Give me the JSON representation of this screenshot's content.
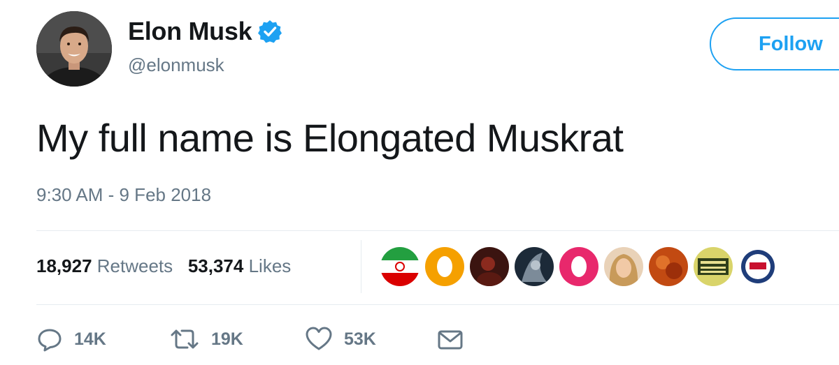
{
  "user": {
    "display_name": "Elon Musk",
    "handle": "@elonmusk",
    "verified": true
  },
  "follow_label": "Follow",
  "tweet": {
    "text": "My full name is Elongated Muskrat",
    "timestamp": "9:30 AM - 9 Feb 2018"
  },
  "stats": {
    "retweets_count": "18,927",
    "retweets_label": "Retweets",
    "likes_count": "53,374",
    "likes_label": "Likes"
  },
  "actions": {
    "reply_count": "14K",
    "retweet_count": "19K",
    "like_count": "53K"
  },
  "colors": {
    "accent": "#1da1f2",
    "secondary_text": "#657786",
    "primary_text": "#14171a",
    "divider": "#e6ecf0"
  },
  "icons": [
    "verified-badge-icon",
    "reply-icon",
    "retweet-icon",
    "like-icon",
    "dm-icon"
  ]
}
